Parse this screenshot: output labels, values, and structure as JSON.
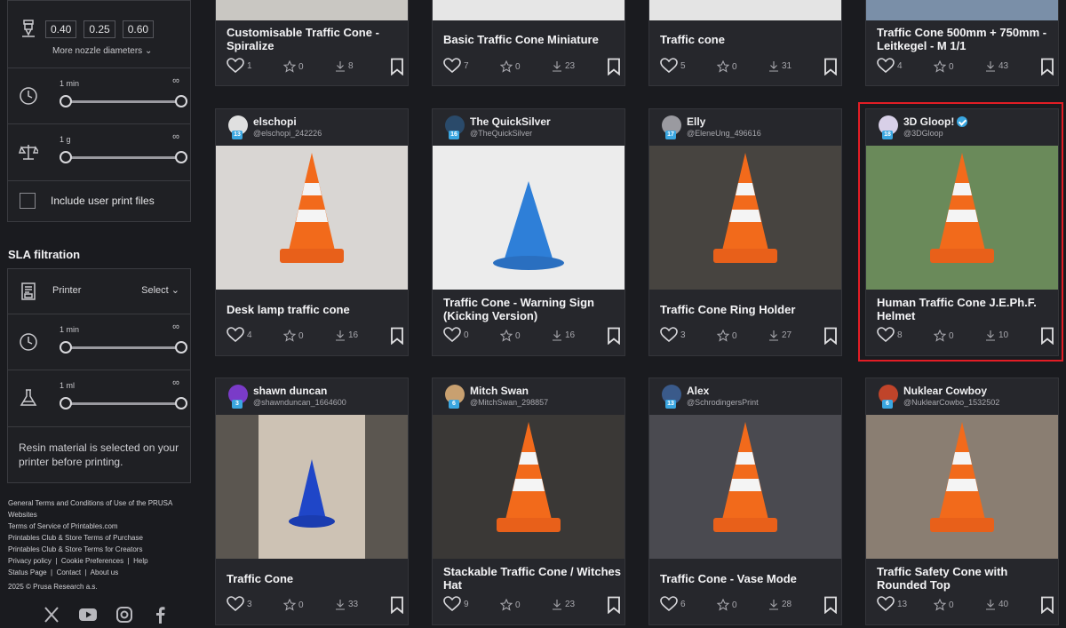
{
  "sidebar": {
    "nozzle_values": [
      "0.40",
      "0.25",
      "0.60"
    ],
    "more_nozzle_label": "More nozzle diameters",
    "time_slider": {
      "min_label": "1 min",
      "max_label": "∞"
    },
    "weight_slider": {
      "min_label": "1 g",
      "max_label": "∞"
    },
    "include_user_prints_label": "Include user print files",
    "sla_title": "SLA filtration",
    "printer_label": "Printer",
    "printer_select": "Select",
    "sla_time_slider": {
      "min_label": "1 min",
      "max_label": "∞"
    },
    "sla_volume_slider": {
      "min_label": "1 ml",
      "max_label": "∞"
    },
    "resin_note": "Resin material is selected on your printer before printing.",
    "footer_links": [
      "General Terms and Conditions of Use of the PRUSA Websites",
      "Terms of Service of Printables.com",
      "Printables Club & Store Terms of Purchase",
      "Printables Club & Store Terms for Creators",
      "Privacy policy",
      "Cookie Preferences",
      "Help",
      "Status Page",
      "Contact",
      "About us"
    ],
    "copyright": "2025 © Prusa Research a.s.",
    "socials": [
      "x-icon",
      "youtube-icon",
      "instagram-icon",
      "facebook-icon"
    ]
  },
  "cards": [
    {
      "title": "Customisable Traffic Cone - Spiralize",
      "likes": "1",
      "stars": "0",
      "downloads": "8"
    },
    {
      "title": "Basic Traffic Cone Miniature",
      "likes": "7",
      "stars": "0",
      "downloads": "23"
    },
    {
      "title": "Traffic cone",
      "likes": "5",
      "stars": "0",
      "downloads": "31"
    },
    {
      "title": "Traffic Cone 500mm + 750mm - Leitkegel - M 1/1",
      "likes": "4",
      "stars": "0",
      "downloads": "43"
    },
    {
      "user": "elschopi",
      "handle": "@elschopi_242226",
      "level": "13",
      "title": "Desk lamp traffic cone",
      "likes": "4",
      "stars": "0",
      "downloads": "16"
    },
    {
      "user": "The QuickSilver",
      "handle": "@TheQuickSilver",
      "level": "16",
      "title": "Traffic Cone - Warning Sign (Kicking Version)",
      "likes": "0",
      "stars": "0",
      "downloads": "16"
    },
    {
      "user": "Elly",
      "handle": "@EleneUng_496616",
      "level": "17",
      "title": "Traffic Cone Ring Holder",
      "likes": "3",
      "stars": "0",
      "downloads": "27"
    },
    {
      "user": "3D Gloop!",
      "handle": "@3DGloop",
      "level": "18",
      "verified": true,
      "title": "Human Traffic Cone J.E.Ph.F. Helmet",
      "likes": "8",
      "stars": "0",
      "downloads": "10"
    },
    {
      "user": "shawn duncan",
      "handle": "@shawnduncan_1664600",
      "level": "3",
      "title": "Traffic Cone",
      "likes": "3",
      "stars": "0",
      "downloads": "33"
    },
    {
      "user": "Mitch Swan",
      "handle": "@MitchSwan_298857",
      "level": "6",
      "title": "Stackable Traffic Cone / Witches Hat",
      "likes": "9",
      "stars": "0",
      "downloads": "23"
    },
    {
      "user": "Alex",
      "handle": "@SchrodingersPrint",
      "level": "13",
      "title": "Traffic Cone - Vase Mode",
      "likes": "6",
      "stars": "0",
      "downloads": "28"
    },
    {
      "user": "Nuklear Cowboy",
      "handle": "@NuklearCowbo_1532502",
      "level": "6",
      "title": "Traffic Safety Cone with Rounded Top",
      "likes": "13",
      "stars": "0",
      "downloads": "40"
    }
  ],
  "colors": {
    "accent_blue": "#3aa6e0",
    "highlight_red": "#e21d25",
    "cone_orange": "#f26a1b"
  }
}
